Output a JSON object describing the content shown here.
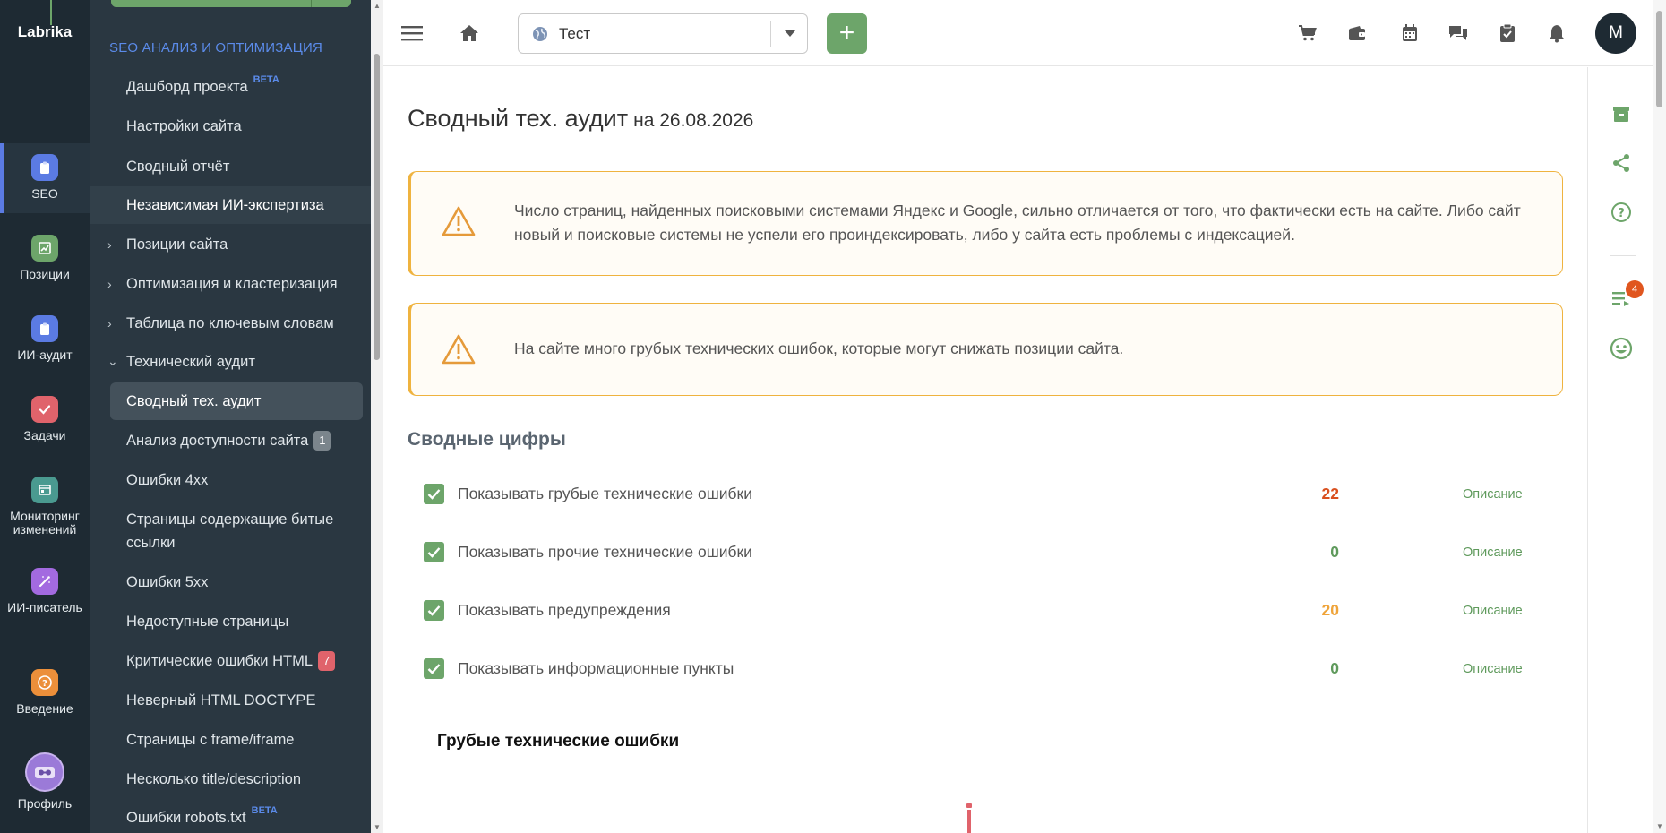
{
  "rail": {
    "logo": "Labrika",
    "items": [
      {
        "label": "SEO",
        "icon": "clipboard-icon",
        "color": "#5b7be3"
      },
      {
        "label": "Позиции",
        "icon": "chart-icon",
        "color": "#6da56a"
      },
      {
        "label": "ИИ-аудит",
        "icon": "clipboard-icon",
        "color": "#5b7be3"
      },
      {
        "label": "Задачи",
        "icon": "check-icon",
        "color": "#e0636b"
      },
      {
        "label": "Мониторинг изменений",
        "icon": "monitor-icon",
        "color": "#4a9a90"
      },
      {
        "label": "ИИ-писатель",
        "icon": "magic-wand-icon",
        "color": "#a36ae0"
      },
      {
        "label": "Введение",
        "icon": "question-icon",
        "color": "#ec8f3a"
      },
      {
        "label": "Профиль",
        "icon": "profile-icon",
        "color": "#9b7ad8"
      }
    ]
  },
  "sidebar": {
    "section": "SEO АНАЛИЗ И ОПТИМИЗАЦИЯ",
    "beta": "BETA",
    "items": [
      {
        "label": "Дашборд проекта"
      },
      {
        "label": "Настройки сайта"
      },
      {
        "label": "Сводный отчёт"
      },
      {
        "label": "Независимая ИИ-экспертиза"
      },
      {
        "label": "Позиции сайта"
      },
      {
        "label": "Оптимизация и кластеризация"
      },
      {
        "label": "Таблица по ключевым словам"
      },
      {
        "label": "Технический аудит"
      },
      {
        "label": "Сводный тех. аудит"
      },
      {
        "label": "Анализ доступности сайта",
        "count": "1"
      },
      {
        "label": "Ошибки 4xx"
      },
      {
        "label": "Страницы содержащие битые ссылки"
      },
      {
        "label": "Ошибки 5xx"
      },
      {
        "label": "Недоступные страницы"
      },
      {
        "label": "Критические ошибки HTML",
        "count": "7"
      },
      {
        "label": "Неверный HTML DOCTYPE"
      },
      {
        "label": "Страницы с frame/iframe"
      },
      {
        "label": "Несколько title/description"
      },
      {
        "label": "Ошибки robots.txt"
      }
    ]
  },
  "topbar": {
    "project": "Тест",
    "add": "+",
    "avatar": "M",
    "icons": [
      "cart-icon",
      "wallet-icon",
      "calendar-icon",
      "chat-icon",
      "clipboard-check-icon",
      "bell-icon"
    ]
  },
  "rightrail": {
    "badge": "4",
    "icons": [
      "archive-icon",
      "share-icon",
      "help-icon",
      "list-icon",
      "support-icon"
    ]
  },
  "main": {
    "title": "Сводный тех. аудит",
    "date": "на 26.08.2026",
    "alerts": [
      "Число страниц, найденных поисковыми системами Яндекс и Google, сильно отличается от того, что фактически есть на сайте. Либо сайт новый и поисковые системы не успели его проиндексировать, либо у сайта есть проблемы с индексацией.",
      "На сайте много грубых технических ошибок, которые могут снижать позиции сайта."
    ],
    "section_title": "Сводные цифры",
    "stats": [
      {
        "label": "Показывать грубые технические ошибки",
        "value": "22",
        "color": "#d9501f",
        "desc": "Описание"
      },
      {
        "label": "Показывать прочие технические ошибки",
        "value": "0",
        "color": "#5f9a5c",
        "desc": "Описание"
      },
      {
        "label": "Показывать предупреждения",
        "value": "20",
        "color": "#efa43a",
        "desc": "Описание"
      },
      {
        "label": "Показывать информационные пункты",
        "value": "0",
        "color": "#5f9a5c",
        "desc": "Описание"
      }
    ],
    "sub_title": "Грубые технические ошибки"
  }
}
